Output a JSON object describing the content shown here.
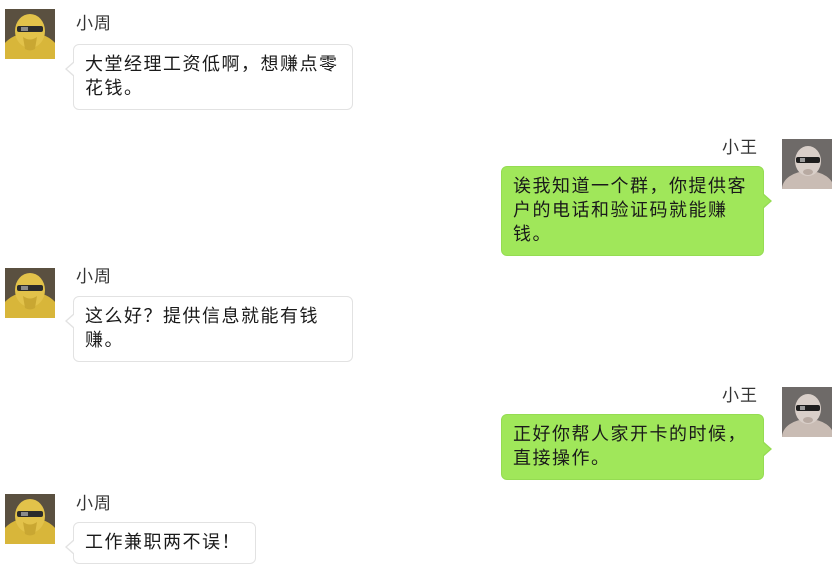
{
  "colors": {
    "sent_bubble": "#a0e75a",
    "received_bubble": "#ffffff",
    "background": "#ffffff"
  },
  "messages": [
    {
      "sender": "小周",
      "side": "left",
      "avatar_icon": "yellow-hooded-figure-avatar",
      "text": "大堂经理工资低啊，想赚点零花钱。"
    },
    {
      "sender": "小王",
      "side": "right",
      "avatar_icon": "masked-figure-avatar",
      "text": "诶我知道一个群，你提供客户的电话和验证码就能赚钱。"
    },
    {
      "sender": "小周",
      "side": "left",
      "avatar_icon": "yellow-hooded-figure-avatar",
      "text": "这么好？提供信息就能有钱赚。"
    },
    {
      "sender": "小王",
      "side": "right",
      "avatar_icon": "masked-figure-avatar",
      "text": "正好你帮人家开卡的时候，直接操作。"
    },
    {
      "sender": "小周",
      "side": "left",
      "avatar_icon": "yellow-hooded-figure-avatar",
      "text": "工作兼职两不误！"
    }
  ]
}
